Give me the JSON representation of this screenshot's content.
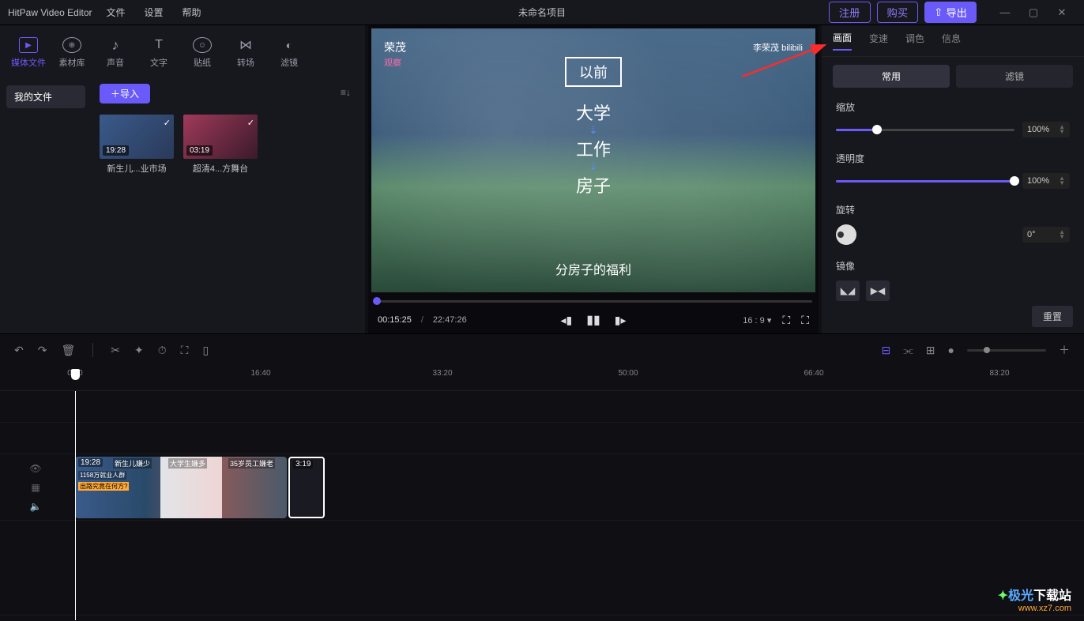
{
  "app_name": "HitPaw Video Editor",
  "menu": {
    "file": "文件",
    "settings": "设置",
    "help": "帮助"
  },
  "project_title": "未命名项目",
  "titlebar_buttons": {
    "register": "注册",
    "buy": "购买",
    "export": "导出"
  },
  "tool_tabs": {
    "media": "媒体文件",
    "library": "素材库",
    "audio": "声音",
    "text": "文字",
    "sticker": "贴纸",
    "transition": "转场",
    "filter": "滤镜"
  },
  "media_sidebar": {
    "my_files": "我的文件"
  },
  "import_button": "＋导入",
  "thumbs": [
    {
      "duration": "19:28",
      "name": "新生儿...业市场"
    },
    {
      "duration": "03:19",
      "name": "超清4...方舞台"
    }
  ],
  "preview_overlay": {
    "brand_line1": "荣茂",
    "brand_line2": "观察",
    "right_credit": "李荣茂  bilibili",
    "box": "以前",
    "stack": [
      "大学",
      "工作",
      "房子"
    ],
    "subtitle": "分房子的福利"
  },
  "preview_time": {
    "current": "00:15:25",
    "total": "22:47:26"
  },
  "aspect_ratio": "16 : 9",
  "prop_tabs": {
    "picture": "画面",
    "speed": "变速",
    "color": "调色",
    "info": "信息"
  },
  "sub_tabs": {
    "common": "常用",
    "filter": "滤镜"
  },
  "properties": {
    "scale": {
      "label": "缩放",
      "value": "100%",
      "percent": 23
    },
    "opacity": {
      "label": "透明度",
      "value": "100%",
      "percent": 100
    },
    "rotate": {
      "label": "旋转",
      "value": "0°"
    },
    "mirror": {
      "label": "镜像"
    },
    "reset": "重置"
  },
  "ruler_ticks": [
    "0:00",
    "16:40",
    "33:20",
    "50:00",
    "66:40",
    "83:20"
  ],
  "timeline_clips": {
    "main_dur": "19:28",
    "seg_labels": [
      "新生儿嫌少",
      "大学生嫌多",
      "35岁员工嫌老"
    ],
    "seg_sub": "1158万就业人群",
    "seg_sub2": "出路究竟在何方?",
    "selected_dur": "3:19"
  },
  "watermark": {
    "line1_a": "极光",
    "line1_b": "下载站",
    "line2": "www.xz7.com"
  }
}
